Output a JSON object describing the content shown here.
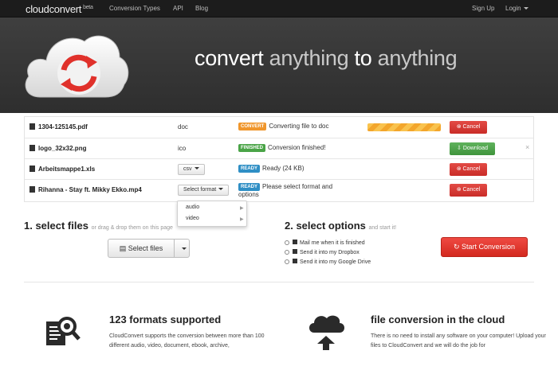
{
  "navbar": {
    "brand": "cloudconvert",
    "brand_badge": "beta",
    "links": [
      "Conversion Types",
      "API",
      "Blog"
    ],
    "sign_up": "Sign Up",
    "login": "Login"
  },
  "hero": {
    "headline_part1": "convert ",
    "headline_part2": "anything",
    "headline_part3": " to ",
    "headline_part4": "anything"
  },
  "files": [
    {
      "name": "1304-125145.pdf",
      "format": "doc",
      "badge": "CONVERT",
      "status": "Converting file to doc",
      "action": "Cancel",
      "progress": 1.0
    },
    {
      "name": "logo_32x32.png",
      "format": "ico",
      "badge": "FINISHED",
      "status": "Conversion finished!",
      "action": "Download",
      "close": "×"
    },
    {
      "name": "Arbeitsmappe1.xls",
      "format": "csv",
      "badge": "READY",
      "status": "Ready (24 KB)",
      "action": "Cancel"
    },
    {
      "name": "Rihanna - Stay ft. Mikky Ekko.mp4",
      "format": "Select format",
      "badge": "READY",
      "status": "Please select format and options",
      "action": "Cancel"
    }
  ],
  "format_dropdown": {
    "items": [
      "audio",
      "video"
    ]
  },
  "select_files": {
    "title": "1. select files",
    "subtitle": "or drag & drop them on this page",
    "button": "Select files"
  },
  "select_options": {
    "title": "2. select options",
    "subtitle": "and start it!",
    "options": [
      "Mail me when it is finished",
      "Send it into my Dropbox",
      "Send it into my Google Drive"
    ],
    "start_button": "Start Conversion"
  },
  "features": [
    {
      "title": "123 formats supported",
      "text": "CloudConvert supports the conversion between more than 100 different audio, video, document, ebook, archive,"
    },
    {
      "title": "file conversion in the cloud",
      "text": "There is no need to install any software on your computer! Upload your files to CloudConvert and we will do the job for"
    }
  ],
  "colors": {
    "navbar": "#1c1c1c",
    "hero": "#3a3a3a",
    "badge_convert": "#f0962c",
    "badge_finished": "#4aa447",
    "badge_ready": "#2f8fc5",
    "danger": "#d9342e",
    "success": "#4aa447",
    "logo_red": "#e0312b"
  },
  "icons": {
    "hero_logo": "cloud-refresh-icon",
    "feature1": "document-magnifier-icon",
    "feature2": "cloud-upload-icon"
  }
}
